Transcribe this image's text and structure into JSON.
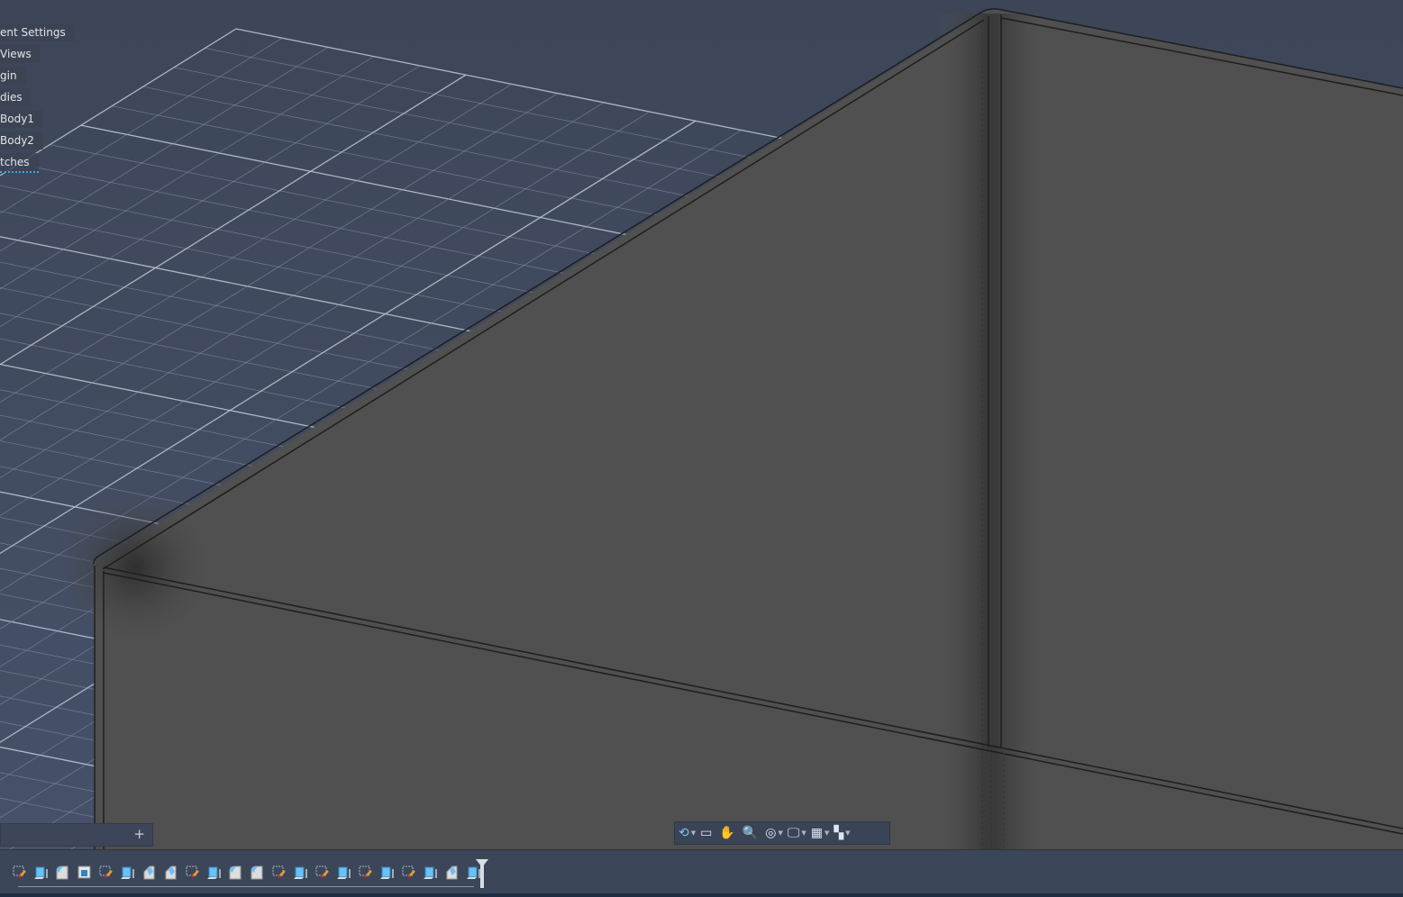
{
  "browser": {
    "items": [
      {
        "label": "ent Settings"
      },
      {
        "label": "Views"
      },
      {
        "label": "gin"
      },
      {
        "label": "dies"
      },
      {
        "label": "Body1"
      },
      {
        "label": "Body2"
      },
      {
        "label": "tches"
      }
    ]
  },
  "comments": {
    "add_label": "+"
  },
  "navbar": {
    "tools": [
      {
        "icon": "orbit-icon",
        "glyph": "⟲",
        "dropdown": true
      },
      {
        "icon": "look-at-icon",
        "glyph": "▭",
        "dropdown": false
      },
      {
        "icon": "pan-hand-icon",
        "glyph": "✋",
        "dropdown": false
      },
      {
        "icon": "zoom-icon",
        "glyph": "🔍",
        "dropdown": false
      },
      {
        "icon": "fit-icon",
        "glyph": "◎",
        "dropdown": true
      },
      {
        "icon": "display-settings-icon",
        "glyph": "🖵",
        "dropdown": true
      },
      {
        "icon": "grid-icon",
        "glyph": "▦",
        "dropdown": true
      },
      {
        "icon": "viewports-icon",
        "glyph": "▚",
        "dropdown": true
      }
    ]
  },
  "timeline": {
    "features": [
      "sketch",
      "extrude",
      "fillet",
      "shell",
      "sketch",
      "extrude",
      "chamfer",
      "chamfer",
      "sketch",
      "extrude",
      "fillet",
      "fillet",
      "sketch",
      "extrude",
      "sketch",
      "extrude",
      "sketch",
      "extrude",
      "sketch",
      "extrude",
      "chamfer",
      "extrude"
    ]
  },
  "colors": {
    "background": "#424c60",
    "body": "#505050",
    "grid": "#8f9bb0",
    "accent": "#3fa6e8"
  }
}
